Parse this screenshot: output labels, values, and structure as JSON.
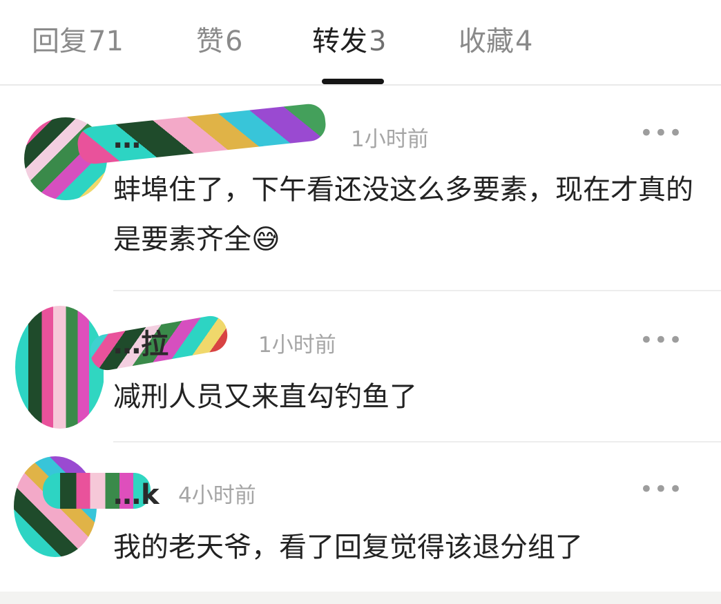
{
  "tabs": [
    {
      "label": "回复",
      "count": "71"
    },
    {
      "label": "赞",
      "count": "6"
    },
    {
      "label": "转发",
      "count": "3"
    },
    {
      "label": "收藏",
      "count": "4"
    }
  ],
  "comments": [
    {
      "nickname": "…",
      "time": "1小时前",
      "text": "蚌埠住了，下午看还没这么多要素，现在才真的是要素齐全😅"
    },
    {
      "nickname": "…拉",
      "time": "1小时前",
      "text": "减刑人员又来直勾钓鱼了"
    },
    {
      "nickname": "…k",
      "time": "4小时前",
      "text": "我的老天爷，看了回复觉得该退分组了"
    }
  ]
}
